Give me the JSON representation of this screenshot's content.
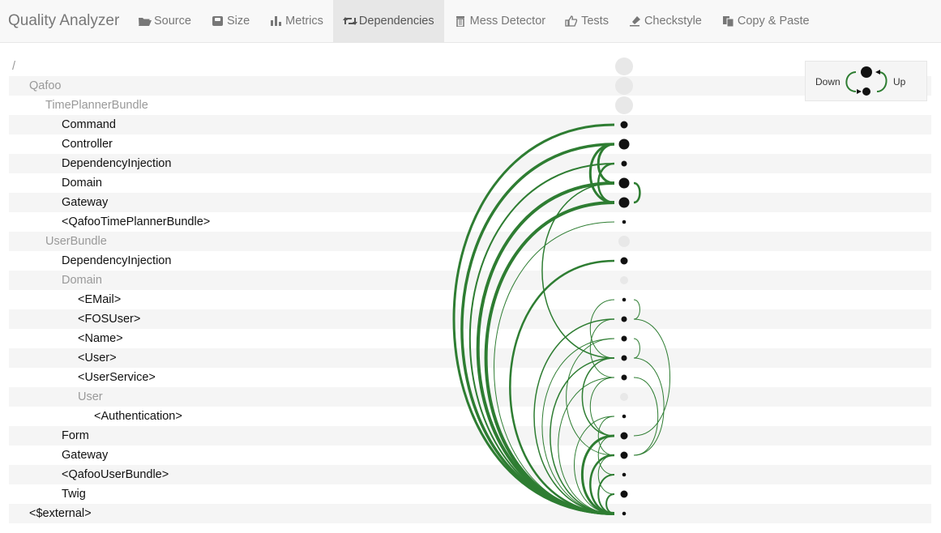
{
  "brand": "Quality Analyzer",
  "nav": [
    {
      "id": "source",
      "label": "Source",
      "icon": "folder-open-icon"
    },
    {
      "id": "size",
      "label": "Size",
      "icon": "scale-icon"
    },
    {
      "id": "metrics",
      "label": "Metrics",
      "icon": "bar-chart-icon"
    },
    {
      "id": "dependencies",
      "label": "Dependencies",
      "icon": "retweet-icon",
      "active": true
    },
    {
      "id": "mess",
      "label": "Mess Detector",
      "icon": "trash-icon"
    },
    {
      "id": "tests",
      "label": "Tests",
      "icon": "thumbs-up-icon"
    },
    {
      "id": "checkstyle",
      "label": "Checkstyle",
      "icon": "highlighter-icon"
    },
    {
      "id": "copypaste",
      "label": "Copy & Paste",
      "icon": "copy-icon"
    }
  ],
  "tree": [
    {
      "label": "/",
      "depth": 0,
      "pkg": true,
      "node": "pkg"
    },
    {
      "label": "Qafoo",
      "depth": 1,
      "pkg": true,
      "node": "pkg"
    },
    {
      "label": "TimePlannerBundle",
      "depth": 2,
      "pkg": true,
      "node": "pkg"
    },
    {
      "label": "Command",
      "depth": 3,
      "node": "m"
    },
    {
      "label": "Controller",
      "depth": 3,
      "node": "l"
    },
    {
      "label": "DependencyInjection",
      "depth": 3,
      "node": "s"
    },
    {
      "label": "Domain",
      "depth": 3,
      "node": "l"
    },
    {
      "label": "Gateway",
      "depth": 3,
      "node": "l"
    },
    {
      "label": "<QafooTimePlannerBundle>",
      "depth": 3,
      "node": "xs"
    },
    {
      "label": "UserBundle",
      "depth": 2,
      "pkg": true,
      "node": "pkgs"
    },
    {
      "label": "DependencyInjection",
      "depth": 3,
      "node": "m"
    },
    {
      "label": "Domain",
      "depth": 3,
      "pkg": true,
      "node": "pkgxs"
    },
    {
      "label": "<EMail>",
      "depth": 4,
      "node": "xs"
    },
    {
      "label": "<FOSUser>",
      "depth": 4,
      "node": "s"
    },
    {
      "label": "<Name>",
      "depth": 4,
      "node": "s"
    },
    {
      "label": "<User>",
      "depth": 4,
      "node": "s"
    },
    {
      "label": "<UserService>",
      "depth": 4,
      "node": "s"
    },
    {
      "label": "User",
      "depth": 4,
      "pkg": true,
      "node": "pkgxs"
    },
    {
      "label": "<Authentication>",
      "depth": 5,
      "node": "xs"
    },
    {
      "label": "Form",
      "depth": 3,
      "node": "m"
    },
    {
      "label": "Gateway",
      "depth": 3,
      "node": "m"
    },
    {
      "label": "<QafooUserBundle>",
      "depth": 3,
      "node": "xs"
    },
    {
      "label": "Twig",
      "depth": 3,
      "node": "m"
    },
    {
      "label": "<$external>",
      "depth": 1,
      "node": "xs"
    }
  ],
  "edges": [
    [
      3,
      23,
      3
    ],
    [
      4,
      23,
      3.5
    ],
    [
      5,
      23,
      2
    ],
    [
      6,
      23,
      4
    ],
    [
      7,
      23,
      4
    ],
    [
      8,
      23,
      1
    ],
    [
      10,
      23,
      2.5
    ],
    [
      13,
      23,
      1.5
    ],
    [
      14,
      23,
      1
    ],
    [
      15,
      23,
      1.5
    ],
    [
      16,
      23,
      1
    ],
    [
      18,
      23,
      1
    ],
    [
      19,
      23,
      3
    ],
    [
      20,
      23,
      2.5
    ],
    [
      21,
      23,
      2
    ],
    [
      22,
      23,
      2
    ],
    [
      4,
      6,
      3
    ],
    [
      4,
      7,
      3
    ],
    [
      5,
      7,
      2.5
    ],
    [
      6,
      15,
      1.5
    ],
    [
      12,
      15,
      1
    ],
    [
      13,
      16,
      1
    ],
    [
      14,
      20,
      1
    ],
    [
      15,
      19,
      1.5
    ],
    [
      16,
      19,
      1
    ],
    [
      18,
      20,
      1
    ],
    [
      19,
      21,
      1
    ],
    [
      20,
      22,
      1
    ]
  ],
  "upEdges": [
    [
      6,
      7,
      2.5
    ],
    [
      12,
      13,
      1
    ],
    [
      13,
      19,
      1
    ],
    [
      14,
      15,
      1
    ],
    [
      15,
      20,
      1
    ],
    [
      16,
      20,
      1
    ]
  ],
  "legend": {
    "down": "Down",
    "up": "Up"
  },
  "colors": {
    "edge": "#2e7d32",
    "node": "#111111",
    "pkgNode": "#e8e8e8"
  }
}
